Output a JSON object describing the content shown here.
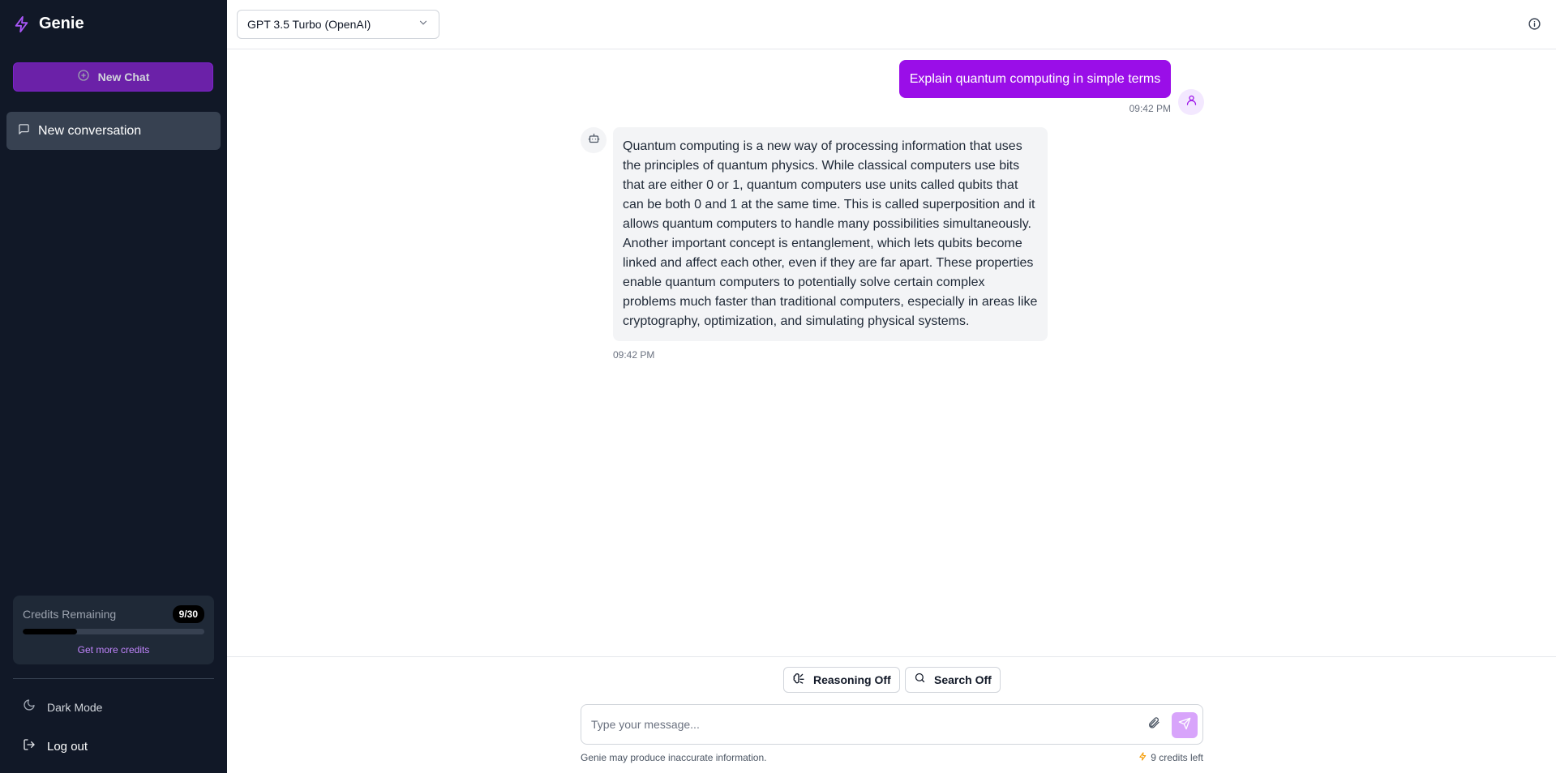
{
  "brand": {
    "name": "Genie",
    "icon": "lightning-icon",
    "accent": "#a855f7"
  },
  "sidebar": {
    "new_chat_label": "New Chat",
    "conversations": [
      {
        "label": "New conversation",
        "icon": "message-square-icon"
      }
    ],
    "credits": {
      "title": "Credits Remaining",
      "badge": "9/30",
      "remaining_fraction": 0.3,
      "link": "Get more credits"
    },
    "dark_mode_label": "Dark Mode",
    "logout_label": "Log out"
  },
  "topbar": {
    "model": "GPT 3.5 Turbo (OpenAI)",
    "info_icon": "info-icon"
  },
  "messages": [
    {
      "role": "user",
      "text": "Explain quantum computing in simple terms",
      "time": "09:42 PM"
    },
    {
      "role": "assistant",
      "text": "Quantum computing is a new way of processing information that uses the principles of quantum physics. While classical computers use bits that are either 0 or 1, quantum computers use units called qubits that can be both 0 and 1 at the same time. This is called superposition and it allows quantum computers to handle many possibilities simultaneously. Another important concept is entanglement, which lets qubits become linked and affect each other, even if they are far apart. These properties enable quantum computers to potentially solve certain complex problems much faster than traditional computers, especially in areas like cryptography, optimization, and simulating physical systems.",
      "time": "09:42 PM"
    }
  ],
  "composer": {
    "reasoning_label": "Reasoning Off",
    "search_label": "Search Off",
    "placeholder": "Type your message...",
    "value": "",
    "disclaimer": "Genie may produce inaccurate information.",
    "credits_left": "9 credits left"
  },
  "colors": {
    "sidebar_bg": "#111827",
    "user_bubble": "#9a0ee8",
    "new_chat_bg": "#6b21a8",
    "send_bg": "#d8a4fb"
  }
}
